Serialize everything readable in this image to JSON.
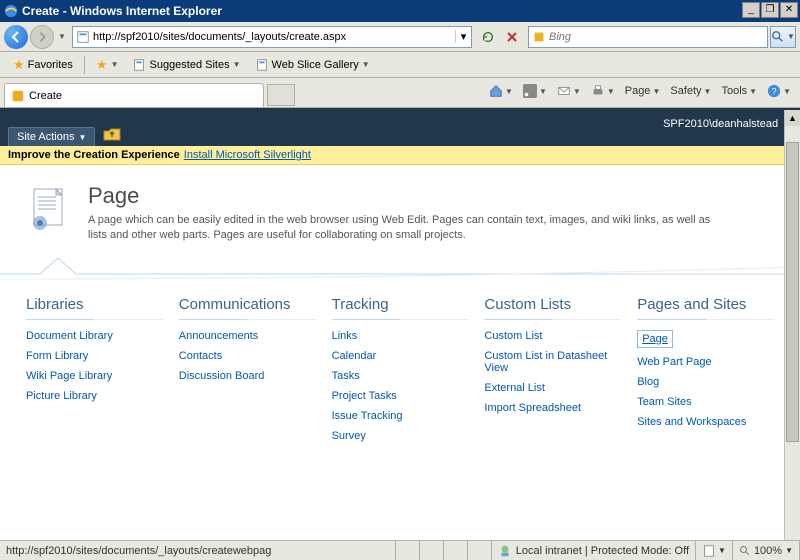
{
  "window": {
    "title": "Create - Windows Internet Explorer"
  },
  "nav": {
    "url": "http://spf2010/sites/documents/_layouts/create.aspx",
    "search_placeholder": "Bing"
  },
  "favorites": {
    "label": "Favorites",
    "suggested": "Suggested Sites",
    "webslice": "Web Slice Gallery"
  },
  "tab": {
    "title": "Create"
  },
  "commandbar": {
    "page": "Page",
    "safety": "Safety",
    "tools": "Tools"
  },
  "ribbon": {
    "site_actions": "Site Actions",
    "user": "SPF2010\\deanhalstead"
  },
  "notif": {
    "bold": "Improve the Creation Experience",
    "link": "Install Microsoft Silverlight"
  },
  "header": {
    "title": "Page",
    "desc": "A page which can be easily edited in the web browser using Web Edit. Pages can contain text, images, and wiki links, as well as lists and other web parts. Pages are useful for collaborating on small projects."
  },
  "columns": {
    "libraries": {
      "title": "Libraries",
      "items": [
        "Document Library",
        "Form Library",
        "Wiki Page Library",
        "Picture Library"
      ]
    },
    "communications": {
      "title": "Communications",
      "items": [
        "Announcements",
        "Contacts",
        "Discussion Board"
      ]
    },
    "tracking": {
      "title": "Tracking",
      "items": [
        "Links",
        "Calendar",
        "Tasks",
        "Project Tasks",
        "Issue Tracking",
        "Survey"
      ]
    },
    "custom": {
      "title": "Custom Lists",
      "items": [
        "Custom List",
        "Custom List in Datasheet View",
        "External List",
        "Import Spreadsheet"
      ]
    },
    "pages": {
      "title": "Pages and Sites",
      "items": [
        "Page",
        "Web Part Page",
        "Blog",
        "Team Sites",
        "Sites and Workspaces"
      ]
    }
  },
  "status": {
    "url": "http://spf2010/sites/documents/_layouts/createwebpag",
    "zone": "Local intranet | Protected Mode: Off",
    "zoom": "100%"
  }
}
